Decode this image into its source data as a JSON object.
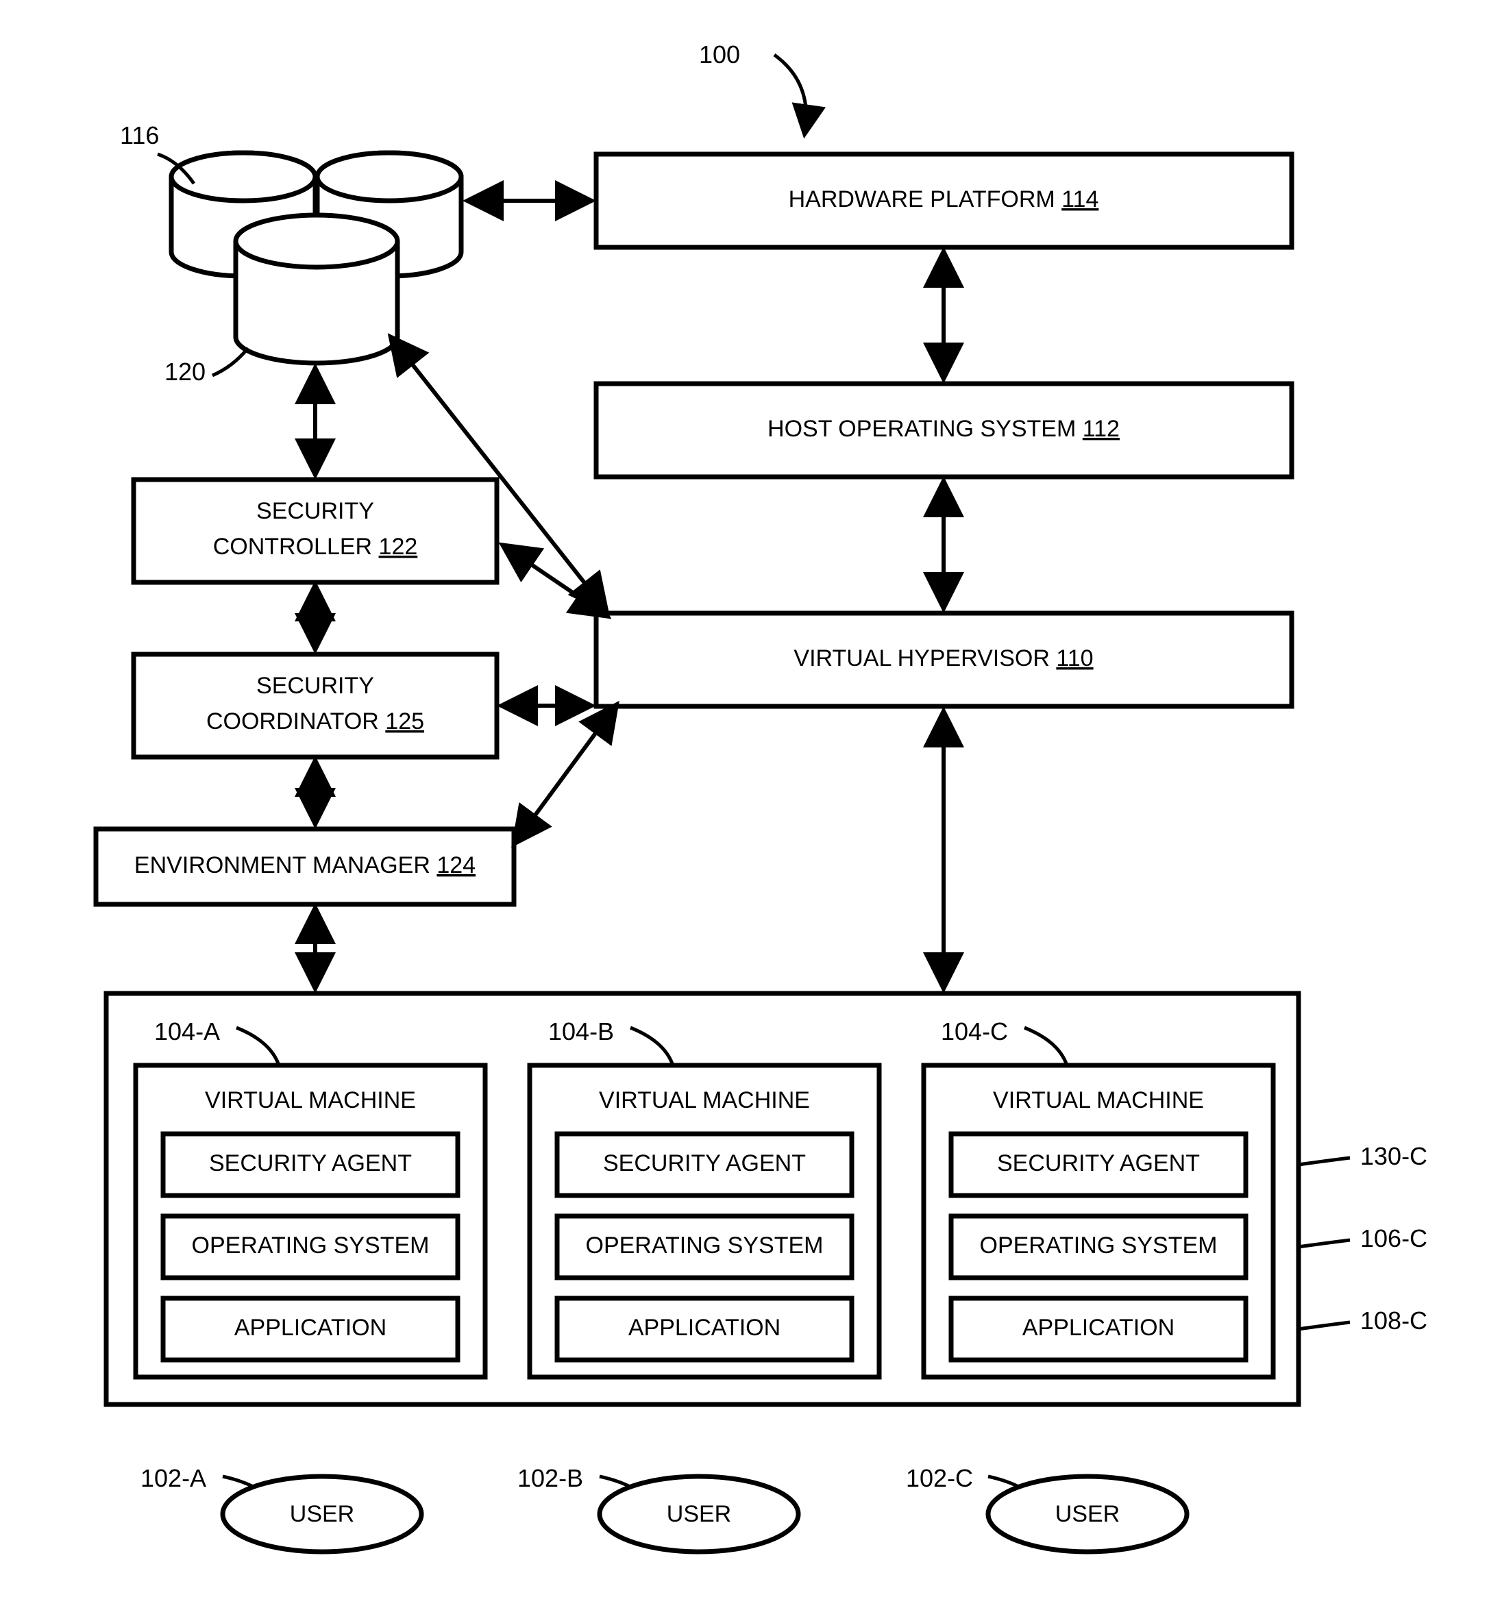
{
  "figure_ref": "100",
  "boxes": {
    "hardware_platform": {
      "label": "HARDWARE PLATFORM",
      "ref": "114"
    },
    "host_os": {
      "label": "HOST OPERATING SYSTEM",
      "ref": "112"
    },
    "hypervisor": {
      "label": "VIRTUAL HYPERVISOR",
      "ref": "110"
    },
    "security_controller": {
      "label1": "SECURITY",
      "label2": "CONTROLLER",
      "ref": "122"
    },
    "security_coord": {
      "label1": "SECURITY",
      "label2": "COORDINATOR",
      "ref": "125"
    },
    "env_manager": {
      "label": "ENVIRONMENT MANAGER",
      "ref": "124"
    }
  },
  "storage_ref_top": "116",
  "storage_ref_bottom": "120",
  "vm": {
    "refs": {
      "a": "104-A",
      "b": "104-B",
      "c": "104-C"
    },
    "title": "VIRTUAL MACHINE",
    "sec_agent": "SECURITY AGENT",
    "os": "OPERATING SYSTEM",
    "app": "APPLICATION",
    "side_refs": {
      "agent": "130-C",
      "os": "106-C",
      "app": "108-C"
    }
  },
  "users": {
    "label": "USER",
    "refs": {
      "a": "102-A",
      "b": "102-B",
      "c": "102-C"
    }
  }
}
